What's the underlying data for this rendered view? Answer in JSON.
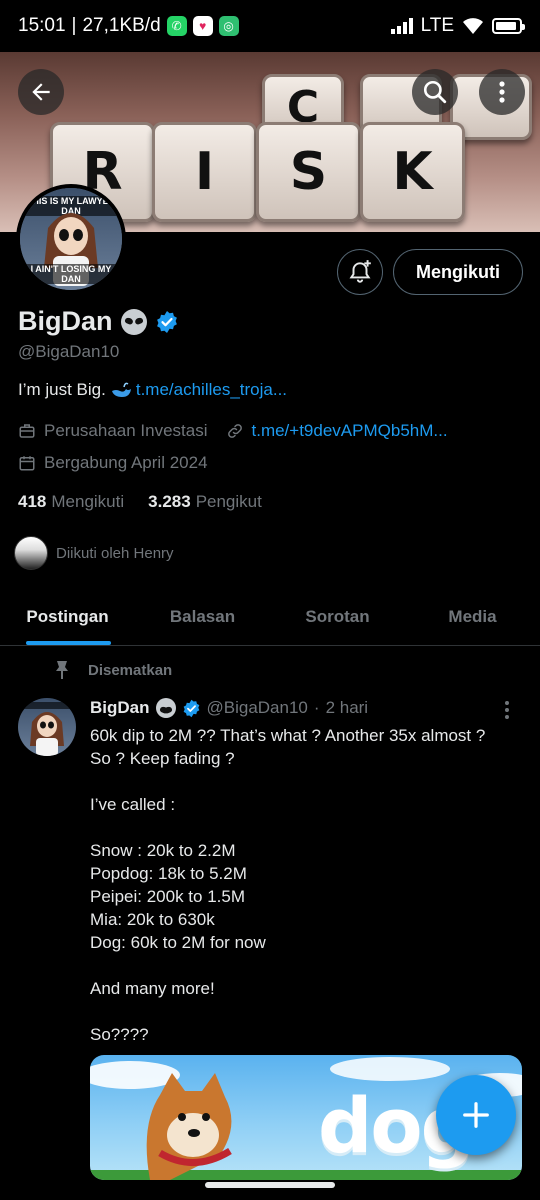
{
  "status_bar": {
    "time": "15:01",
    "separator": "|",
    "data_rate": "27,1KB/d",
    "network": "LTE",
    "app_icons": [
      "whatsapp-icon",
      "notification-icon",
      "app-icon"
    ]
  },
  "banner": {
    "tiles_top": [
      "C"
    ],
    "tiles_main": [
      "R",
      "I",
      "S",
      "K"
    ],
    "actions": [
      "back-arrow-icon",
      "search-icon",
      "more-vertical-icon"
    ]
  },
  "avatar": {
    "caption_top": "THIS IS MY LAWYER DAN",
    "caption_bottom": "I AIN'T LOSING MY DAN"
  },
  "profile": {
    "follow_button": "Mengikuti",
    "name": "BigDan",
    "handle": "@BigaDan10",
    "bio_text": "I’m just Big.",
    "bio_link": "t.me/achilles_troja...",
    "category": "Perusahaan Investasi",
    "website": "t.me/+t9devAPMQb5hM...",
    "joined": "Bergabung April 2024",
    "following_count": "418",
    "following_label": "Mengikuti",
    "followers_count": "3.283",
    "followers_label": "Pengikut",
    "followed_by": "Diikuti oleh Henry"
  },
  "tabs": [
    {
      "label": "Postingan",
      "active": true
    },
    {
      "label": "Balasan",
      "active": false
    },
    {
      "label": "Sorotan",
      "active": false
    },
    {
      "label": "Media",
      "active": false
    }
  ],
  "post": {
    "pinned_label": "Disematkan",
    "name": "BigDan",
    "handle": "@BigaDan10",
    "dot": "·",
    "time": "2 hari",
    "lines": [
      "60k dip to 2M ?? That’s what ? Another 35x almost ?",
      "So ? Keep fading ?",
      "",
      "I’ve called :",
      "",
      "Snow : 20k to 2.2M",
      "Popdog: 18k to 5.2M",
      "Peipei: 200k to 1.5M",
      "Mia: 20k to 630k",
      "Dog: 60k to 2M for now",
      "",
      "And many more!",
      "",
      "So????"
    ],
    "media_word": "dog"
  },
  "colors": {
    "accent": "#1d9bf0",
    "background": "#000000",
    "secondary_text": "#71767b",
    "primary_text": "#e7e9ea"
  }
}
